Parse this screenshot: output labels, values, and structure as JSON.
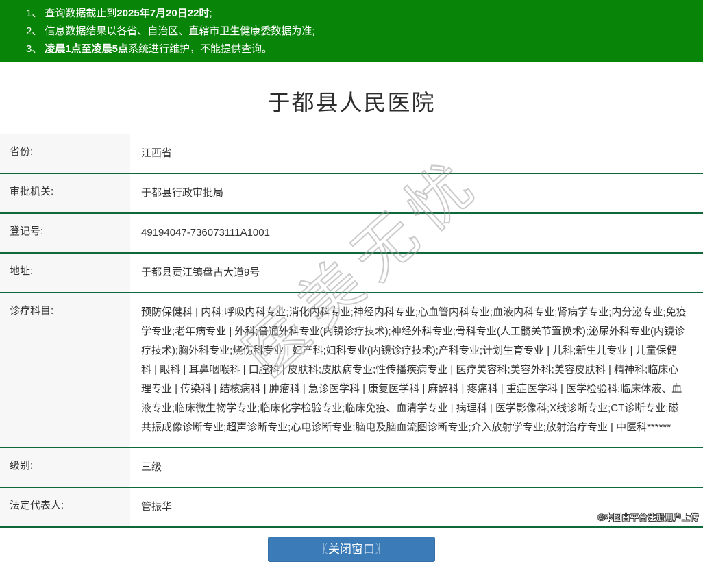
{
  "notice": {
    "lines": [
      {
        "num": "1、",
        "pre": "查询数据截止到",
        "bold": "2025年7月20日22时",
        "post": ";"
      },
      {
        "num": "2、",
        "pre": "信息数据结果以各省、自治区、直辖市卫生健康委数据为准;",
        "bold": "",
        "post": ""
      },
      {
        "num": "3、",
        "pre": "",
        "bold": "凌晨1点至凌晨5点",
        "post": "系统进行维护，不能提供查询。"
      }
    ]
  },
  "page": {
    "title": "于都县人民医院"
  },
  "table": {
    "rows": [
      {
        "label": "省份:",
        "value": "江西省"
      },
      {
        "label": "审批机关:",
        "value": "于都县行政审批局"
      },
      {
        "label": "登记号:",
        "value": "49194047-736073111A1001"
      },
      {
        "label": "地址:",
        "value": "于都县贡江镇盘古大道9号"
      },
      {
        "label": "诊疗科目:",
        "value": "预防保健科 | 内科;呼吸内科专业;消化内科专业;神经内科专业;心血管内科专业;血液内科专业;肾病学专业;内分泌专业;免疫学专业;老年病专业 | 外科;普通外科专业(内镜诊疗技术);神经外科专业;骨科专业(人工髋关节置换术);泌尿外科专业(内镜诊疗技术);胸外科专业;烧伤科专业 | 妇产科;妇科专业(内镜诊疗技术);产科专业;计划生育专业 | 儿科;新生儿专业 | 儿童保健科 | 眼科 | 耳鼻咽喉科 | 口腔科 | 皮肤科;皮肤病专业;性传播疾病专业 | 医疗美容科;美容外科;美容皮肤科 | 精神科;临床心理专业 | 传染科 | 结核病科 | 肿瘤科 | 急诊医学科 | 康复医学科 | 麻醉科 | 疼痛科 | 重症医学科 | 医学检验科;临床体液、血液专业;临床微生物学专业;临床化学检验专业;临床免疫、血清学专业 | 病理科 | 医学影像科;X线诊断专业;CT诊断专业;磁共振成像诊断专业;超声诊断专业;心电诊断专业;脑电及脑血流图诊断专业;介入放射学专业;放射治疗专业 | 中医科******"
      },
      {
        "label": "级别:",
        "value": "三级"
      },
      {
        "label": "法定代表人:",
        "value": "管振华"
      }
    ]
  },
  "footer": {
    "close_button": "〖关闭窗口〗",
    "attribution": "©本图由平台注册用户上传"
  },
  "watermark": {
    "text": "医美无忧"
  },
  "colors": {
    "header_green": "#088408",
    "divider_green": "#0e683a",
    "label_bg": "#f7f7f7",
    "button_blue": "#3b7cb8",
    "text": "#333333"
  }
}
